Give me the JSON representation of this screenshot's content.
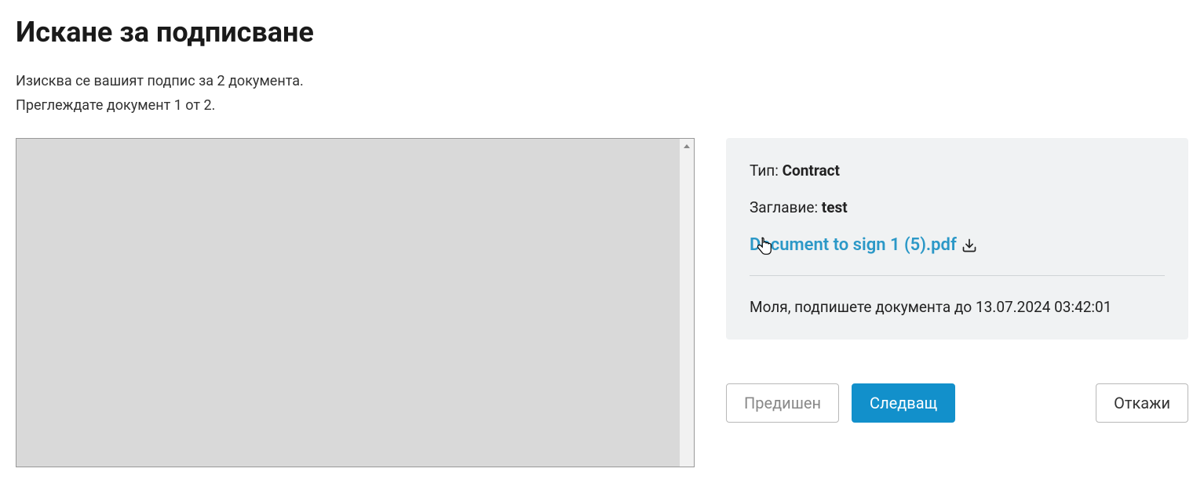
{
  "header": {
    "title": "Искане за подписване",
    "line1": "Изисква се вашият подпис за 2 документа.",
    "line2": "Преглеждате документ 1 от 2."
  },
  "info": {
    "type_label": "Тип: ",
    "type_value": "Contract",
    "title_label": "Заглавие: ",
    "title_value": "test",
    "file_name": "Document to sign 1 (5).pdf",
    "deadline_prefix": "Моля, подпишете документа до ",
    "deadline_value": "13.07.2024 03:42:01"
  },
  "buttons": {
    "previous": "Предишен",
    "next": "Следващ",
    "cancel": "Откажи"
  }
}
